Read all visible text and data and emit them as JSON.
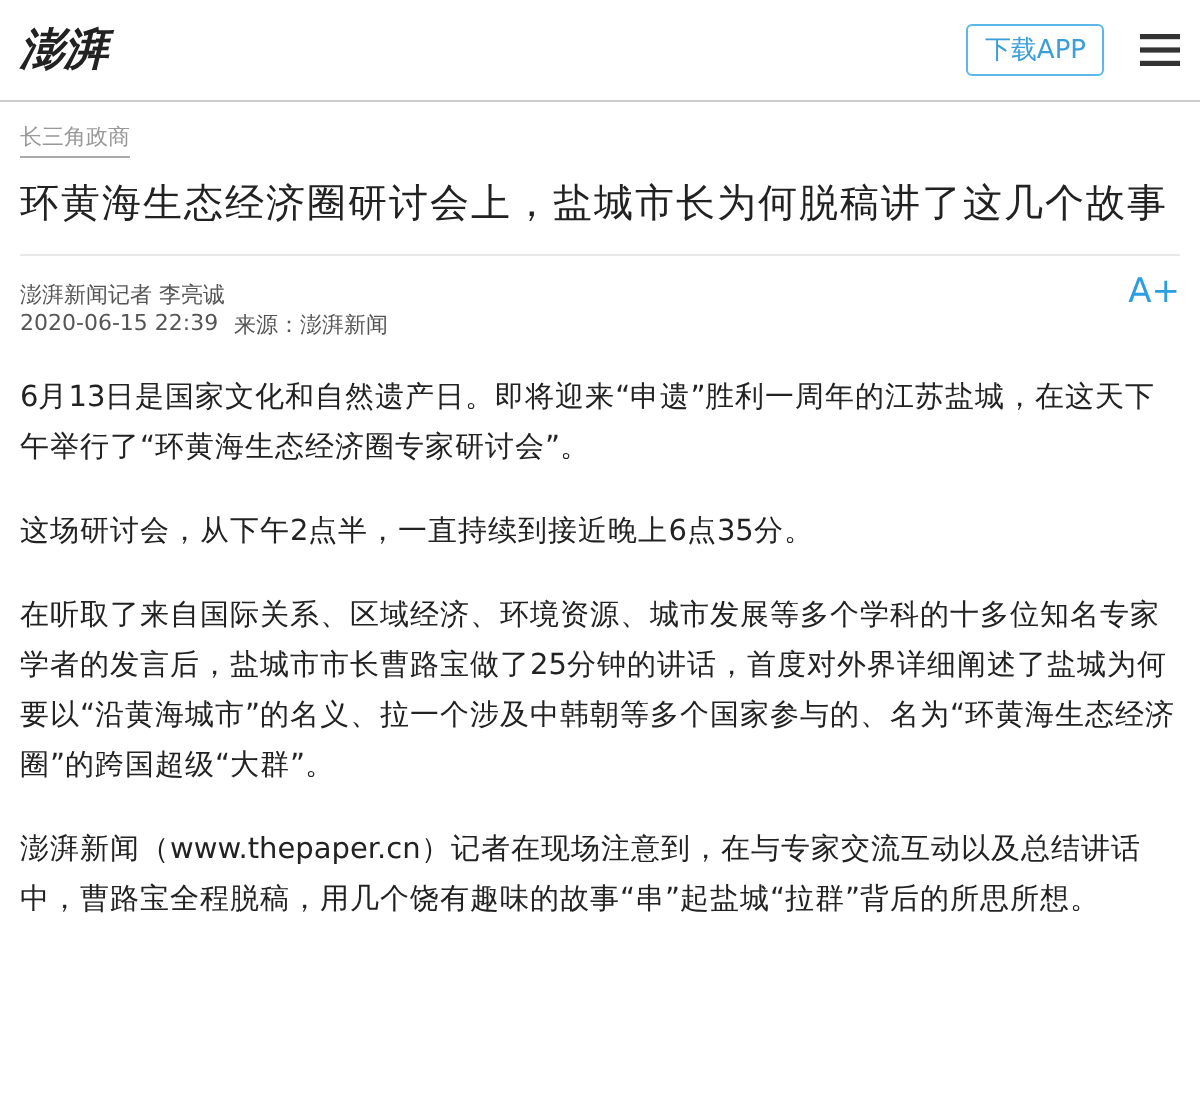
{
  "header": {
    "logo": "澎湃",
    "download_button": "下载APP"
  },
  "category": "长三角政商",
  "title": "环黄海生态经济圈研讨会上，盐城市长为何脱稿讲了这几个故事",
  "byline": {
    "author": "澎湃新闻记者 李亮诚",
    "date": "2020-06-15 22:39",
    "source": "来源：澎湃新闻",
    "font_button": "A+"
  },
  "paragraphs": [
    "6月13日是国家文化和自然遗产日。即将迎来“申遗”胜利一周年的江苏盐城，在这天下午举行了“环黄海生态经济圈专家研讨会”。",
    "这场研讨会，从下午2点半，一直持续到接近晚上6点35分。",
    "在听取了来自国际关系、区域经济、环境资源、城市发展等多个学科的十多位知名专家学者的发言后，盐城市市长曹路宝做了25分钟的讲话，首度对外界详细阐述了盐城为何要以“沿黄海城市”的名义、拉一个涉及中韩朝等多个国家参与的、名为“环黄海生态经济圈”的跨国超级“大群”。",
    "澎湃新闻（www.thepaper.cn）记者在现场注意到，在与专家交流互动以及总结讲话中，曹路宝全程脱稿，用几个饶有趣味的故事“串”起盐城“拉群”背后的所思所想。"
  ]
}
